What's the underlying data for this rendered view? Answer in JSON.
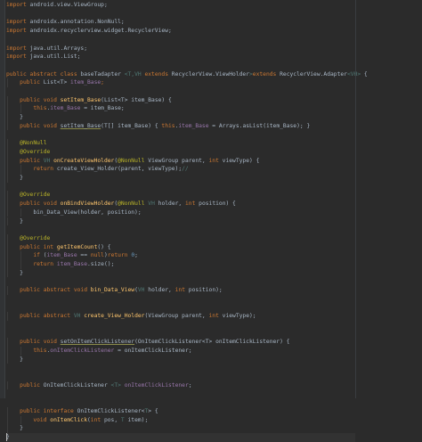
{
  "editor": {
    "background": "#2b2b2b",
    "colors": {
      "keyword": "#cc7832",
      "plain": "#a9b7c6",
      "generic": "#507874",
      "field": "#9876aa",
      "method": "#ffc66d",
      "annotation": "#bbb529",
      "number": "#6897bb"
    },
    "lines": [
      [
        [
          "import",
          "keyword"
        ],
        [
          " android.view.ViewGroup;",
          "plain"
        ]
      ],
      [],
      [
        [
          "import",
          "keyword"
        ],
        [
          " androidx.annotation.NonNull;",
          "plain"
        ]
      ],
      [
        [
          "import",
          "keyword"
        ],
        [
          " androidx.recyclerview.widget.RecyclerView;",
          "plain"
        ]
      ],
      [],
      [
        [
          "import",
          "keyword"
        ],
        [
          " java.util.Arrays;",
          "plain"
        ]
      ],
      [
        [
          "import",
          "keyword"
        ],
        [
          " java.util.List;",
          "plain"
        ]
      ],
      [],
      [
        [
          "public abstract class",
          "keyword"
        ],
        [
          " baseTadapter ",
          "plain"
        ],
        [
          "<T,VH ",
          "generic"
        ],
        [
          "extends",
          "keyword"
        ],
        [
          " RecyclerView.ViewHolder",
          "plain"
        ],
        [
          ">",
          "generic"
        ],
        [
          "extends",
          "keyword"
        ],
        [
          " RecyclerView.Adapter",
          "plain"
        ],
        [
          "<VH>",
          "generic"
        ],
        [
          " {",
          "plain"
        ]
      ],
      [
        [
          "    public",
          "keyword"
        ],
        [
          " List<T> ",
          "plain"
        ],
        [
          "item_Base",
          "field"
        ],
        [
          ";",
          "keyword"
        ]
      ],
      [],
      [
        [
          "    public void",
          "keyword"
        ],
        [
          " ",
          "plain"
        ],
        [
          "setItem_Base",
          "method"
        ],
        [
          "(List<T> item_Base) {",
          "plain"
        ]
      ],
      [
        [
          "        this",
          "keyword"
        ],
        [
          ".",
          "plain"
        ],
        [
          "item_Base",
          "field"
        ],
        [
          " = item_Base;",
          "plain"
        ]
      ],
      [
        [
          "    }",
          "plain"
        ]
      ],
      [
        [
          "    public void",
          "keyword"
        ],
        [
          " ",
          "plain"
        ],
        [
          "setItem_Base",
          "warn"
        ],
        [
          "(T[] item_Base) { ",
          "plain"
        ],
        [
          "this",
          "keyword"
        ],
        [
          ".",
          "plain"
        ],
        [
          "item_Base",
          "field"
        ],
        [
          " = Arrays.",
          "plain"
        ],
        [
          "asList",
          "plain"
        ],
        [
          "(item_Base); }",
          "plain"
        ]
      ],
      [],
      [
        [
          "    @NonNull",
          "annotation"
        ]
      ],
      [
        [
          "    @Override",
          "annotation"
        ]
      ],
      [
        [
          "    public",
          "keyword"
        ],
        [
          " VH ",
          "generic"
        ],
        [
          "onCreateViewHolder",
          "method"
        ],
        [
          "(",
          "plain"
        ],
        [
          "@NonNull",
          "annotation"
        ],
        [
          " ViewGroup parent, ",
          "plain"
        ],
        [
          "int",
          "keyword"
        ],
        [
          " viewType) {",
          "plain"
        ]
      ],
      [
        [
          "        return",
          "keyword"
        ],
        [
          " create_View_Holder(parent, viewType);",
          "plain"
        ],
        [
          "//",
          "generic"
        ]
      ],
      [
        [
          "    }",
          "plain"
        ]
      ],
      [],
      [
        [
          "    @Override",
          "annotation"
        ]
      ],
      [
        [
          "    public void",
          "keyword"
        ],
        [
          " ",
          "plain"
        ],
        [
          "onBindViewHolder",
          "method"
        ],
        [
          "(",
          "plain"
        ],
        [
          "@NonNull",
          "annotation"
        ],
        [
          " VH",
          "generic"
        ],
        [
          " holder, ",
          "plain"
        ],
        [
          "int",
          "keyword"
        ],
        [
          " position) {",
          "plain"
        ]
      ],
      [
        [
          "        bin_Data_View(holder, position);",
          "plain"
        ]
      ],
      [
        [
          "    }",
          "plain"
        ]
      ],
      [],
      [
        [
          "    @Override",
          "annotation"
        ]
      ],
      [
        [
          "    public int",
          "keyword"
        ],
        [
          " ",
          "plain"
        ],
        [
          "getItemCount",
          "method"
        ],
        [
          "() {",
          "plain"
        ]
      ],
      [
        [
          "        if",
          "keyword"
        ],
        [
          " (",
          "plain"
        ],
        [
          "item_Base",
          "field"
        ],
        [
          " == ",
          "plain"
        ],
        [
          "null",
          "keyword"
        ],
        [
          ")",
          "plain"
        ],
        [
          "return",
          "keyword"
        ],
        [
          " ",
          "plain"
        ],
        [
          "0",
          "number"
        ],
        [
          ";",
          "plain"
        ]
      ],
      [
        [
          "        return",
          "keyword"
        ],
        [
          " ",
          "plain"
        ],
        [
          "item_Base",
          "field"
        ],
        [
          ".size();",
          "plain"
        ]
      ],
      [
        [
          "    }",
          "plain"
        ]
      ],
      [],
      [
        [
          "    public abstract void",
          "keyword"
        ],
        [
          " ",
          "plain"
        ],
        [
          "bin_Data_View",
          "method"
        ],
        [
          "(",
          "plain"
        ],
        [
          "VH",
          "generic"
        ],
        [
          " holder, ",
          "plain"
        ],
        [
          "int",
          "keyword"
        ],
        [
          " position);",
          "plain"
        ]
      ],
      [],
      [],
      [
        [
          "    public abstract",
          "keyword"
        ],
        [
          " VH ",
          "generic"
        ],
        [
          "create_View_Holder",
          "method"
        ],
        [
          "(ViewGroup parent, ",
          "plain"
        ],
        [
          "int",
          "keyword"
        ],
        [
          " viewType);",
          "plain"
        ]
      ],
      [],
      [],
      [
        [
          "    public void",
          "keyword"
        ],
        [
          " ",
          "plain"
        ],
        [
          "setOnItemClickListener",
          "warn"
        ],
        [
          "(OnItemClickListener<T> onItemClickListener) {",
          "plain"
        ]
      ],
      [
        [
          "        this",
          "keyword"
        ],
        [
          ".",
          "plain"
        ],
        [
          "onItemClickListener",
          "field"
        ],
        [
          " = onItemClickListener;",
          "plain"
        ]
      ],
      [
        [
          "    }",
          "plain"
        ]
      ],
      [],
      [],
      [
        [
          "    public",
          "keyword"
        ],
        [
          " OnItemClickListener ",
          "plain"
        ],
        [
          "<T>",
          "generic"
        ],
        [
          " ",
          "plain"
        ],
        [
          "onItemClickListener",
          "field"
        ],
        [
          ";",
          "plain"
        ]
      ],
      [],
      [],
      [
        [
          "    public interface",
          "keyword"
        ],
        [
          " OnItemClickListener<",
          "plain"
        ],
        [
          "T",
          "generic"
        ],
        [
          "> {",
          "plain"
        ]
      ],
      [
        [
          "        void",
          "keyword"
        ],
        [
          " ",
          "plain"
        ],
        [
          "onItemClick",
          "method"
        ],
        [
          "(",
          "plain"
        ],
        [
          "int",
          "keyword"
        ],
        [
          " pos, ",
          "plain"
        ],
        [
          "T",
          "generic"
        ],
        [
          " item);",
          "plain"
        ]
      ],
      [
        [
          "    }",
          "plain"
        ]
      ],
      [
        [
          "}",
          "plain"
        ]
      ]
    ]
  }
}
